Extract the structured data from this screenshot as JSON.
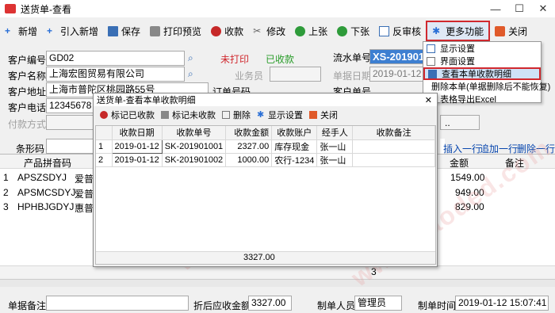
{
  "window": {
    "title": "送货单-查看"
  },
  "toolbar": [
    "新增",
    "引入新增",
    "保存",
    "打印预览",
    "收款",
    "修改",
    "上张",
    "下张",
    "反审核",
    "更多功能",
    "关闭"
  ],
  "form": {
    "customer_code_label": "客户编号",
    "customer_code": "GD02",
    "print_status": "未打印",
    "receipt_status": "已收款",
    "serial_label": "流水单号",
    "serial_value": "XS-201901",
    "customer_name_label": "客户名称",
    "customer_name": "上海宏图贸易有限公司",
    "salesman_label": "业务员",
    "date_label": "单据日期",
    "date_value": "2019-01-12",
    "address_label": "客户地址",
    "address": "上海市普陀区桃园路55号",
    "order_label": "订单号码",
    "customer_no_label": "客户单号",
    "phone_label": "客户电话",
    "phone": "12345678",
    "payment_label": "付款方式",
    "barcode_label": "条形码"
  },
  "row_actions": [
    "插入一行",
    "追加一行",
    "删除一行"
  ],
  "main_table": {
    "headers": [
      "产品拼音码",
      "",
      "金额",
      "备注"
    ],
    "rows": [
      {
        "no": "1",
        "code": "APSZSDYJ",
        "name": "爱普",
        "amount": "1549.00"
      },
      {
        "no": "2",
        "code": "APSMCSDYJ",
        "name": "爱普",
        "amount": "949.00"
      },
      {
        "no": "3",
        "code": "HPHBJGDYJ",
        "name": "惠普",
        "amount": "829.00"
      }
    ],
    "total_qty": "3"
  },
  "menu": [
    "显示设置",
    "界面设置",
    "查看本单收款明细",
    "删除本单(单据删除后不能恢复)",
    "表格导出Excel"
  ],
  "dialog": {
    "title": "送货单-查看本单收款明细",
    "buttons": [
      "标记已收款",
      "标记未收款",
      "删除",
      "显示设置",
      "关闭"
    ],
    "headers": [
      "收款日期",
      "收款单号",
      "收款金额",
      "收款账户",
      "经手人",
      "收款备注"
    ],
    "rows": [
      {
        "no": "1",
        "date": "2019-01-12",
        "code": "SK-201901001",
        "amount": "2327.00",
        "account": "库存现金",
        "handler": "张一山",
        "note": ""
      },
      {
        "no": "2",
        "date": "2019-01-12",
        "code": "SK-201901002",
        "amount": "1000.00",
        "account": "农行-1234",
        "handler": "张一山",
        "note": ""
      }
    ],
    "total": "3327.00"
  },
  "footer": {
    "remark_label": "单据备注",
    "due_label": "折后应收金额",
    "due": "3327.00",
    "maker_label": "制单人员",
    "maker": "管理员",
    "time_label": "制单时间",
    "time": "2019-01-12 15:07:41"
  },
  "watermark": "www.haoded.com",
  "colors": {
    "highlight": "#d0282e",
    "red_text": "#d0282e",
    "green_text": "#2a9d2a",
    "selection": "#3d7fd1"
  }
}
